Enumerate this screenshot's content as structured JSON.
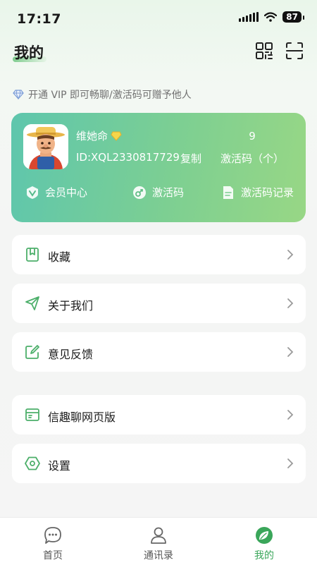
{
  "status_bar": {
    "time": "17:17",
    "battery": "87"
  },
  "header": {
    "title": "我的"
  },
  "vip_tip": "开通 VIP 即可畅聊/激活码可赠予他人",
  "profile": {
    "name": "维她命",
    "id_text": "ID:XQL2330817729",
    "copy_label": "复制",
    "code_count": "9",
    "code_label": "激活码（个）",
    "actions": [
      {
        "label": "会员中心",
        "icon": "vip-badge-icon"
      },
      {
        "label": "激活码",
        "icon": "key-icon"
      },
      {
        "label": "激活码记录",
        "icon": "document-icon"
      }
    ]
  },
  "menu": [
    {
      "label": "收藏",
      "icon": "bookmark-icon"
    },
    {
      "label": "关于我们",
      "icon": "send-icon"
    },
    {
      "label": "意见反馈",
      "icon": "edit-icon"
    },
    {
      "label": "信趣聊网页版",
      "icon": "browser-icon"
    },
    {
      "label": "设置",
      "icon": "settings-hex-icon"
    }
  ],
  "tabs": [
    {
      "label": "首页",
      "icon": "chat-bubble-icon"
    },
    {
      "label": "通讯录",
      "icon": "contacts-icon"
    },
    {
      "label": "我的",
      "icon": "leaf-icon",
      "active": true
    }
  ],
  "colors": {
    "accent": "#3aa65a",
    "card_start": "#5ec6ad",
    "card_end": "#98d785"
  }
}
